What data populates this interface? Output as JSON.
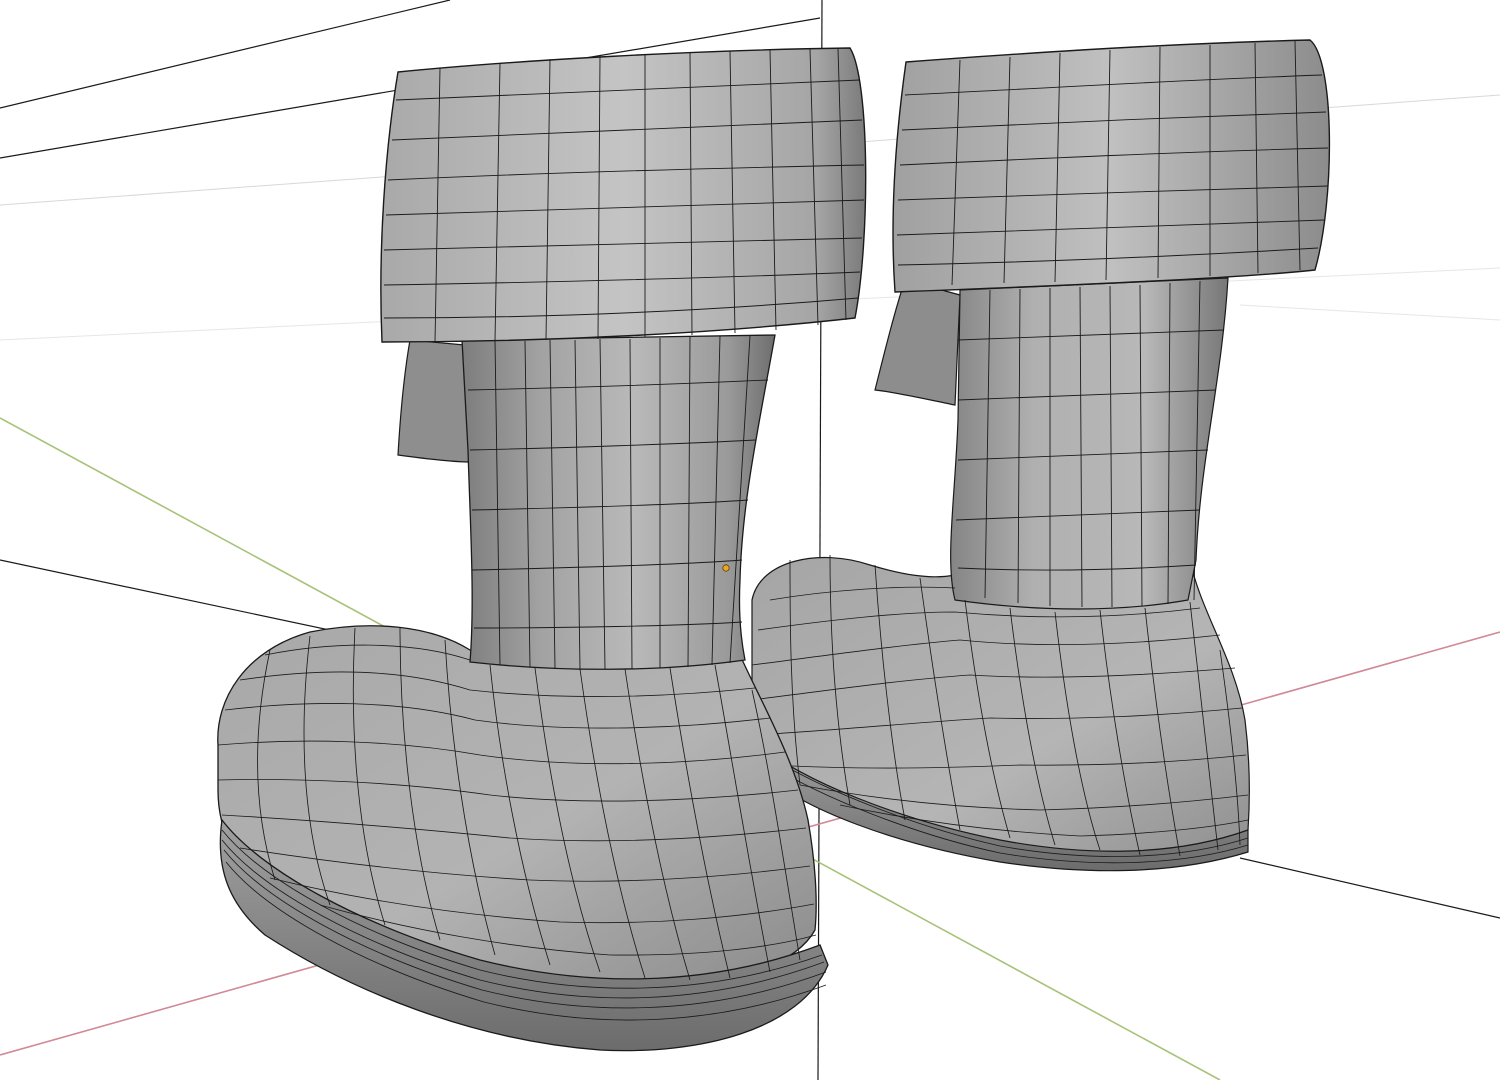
{
  "viewport": {
    "mode": "solid-wireframe",
    "background_color": "#ffffff",
    "mesh_color": "#9a9a9a",
    "wire_color": "#1a1a1a",
    "x_axis_color": "#d08a96",
    "y_axis_color": "#a8c27a",
    "origin_dot_color": "#f2a522"
  },
  "scene": {
    "objects": [
      {
        "name": "boot-left",
        "selected": false
      },
      {
        "name": "boot-right",
        "selected": false
      }
    ]
  },
  "icons": {
    "origin": "origin-dot-icon"
  }
}
